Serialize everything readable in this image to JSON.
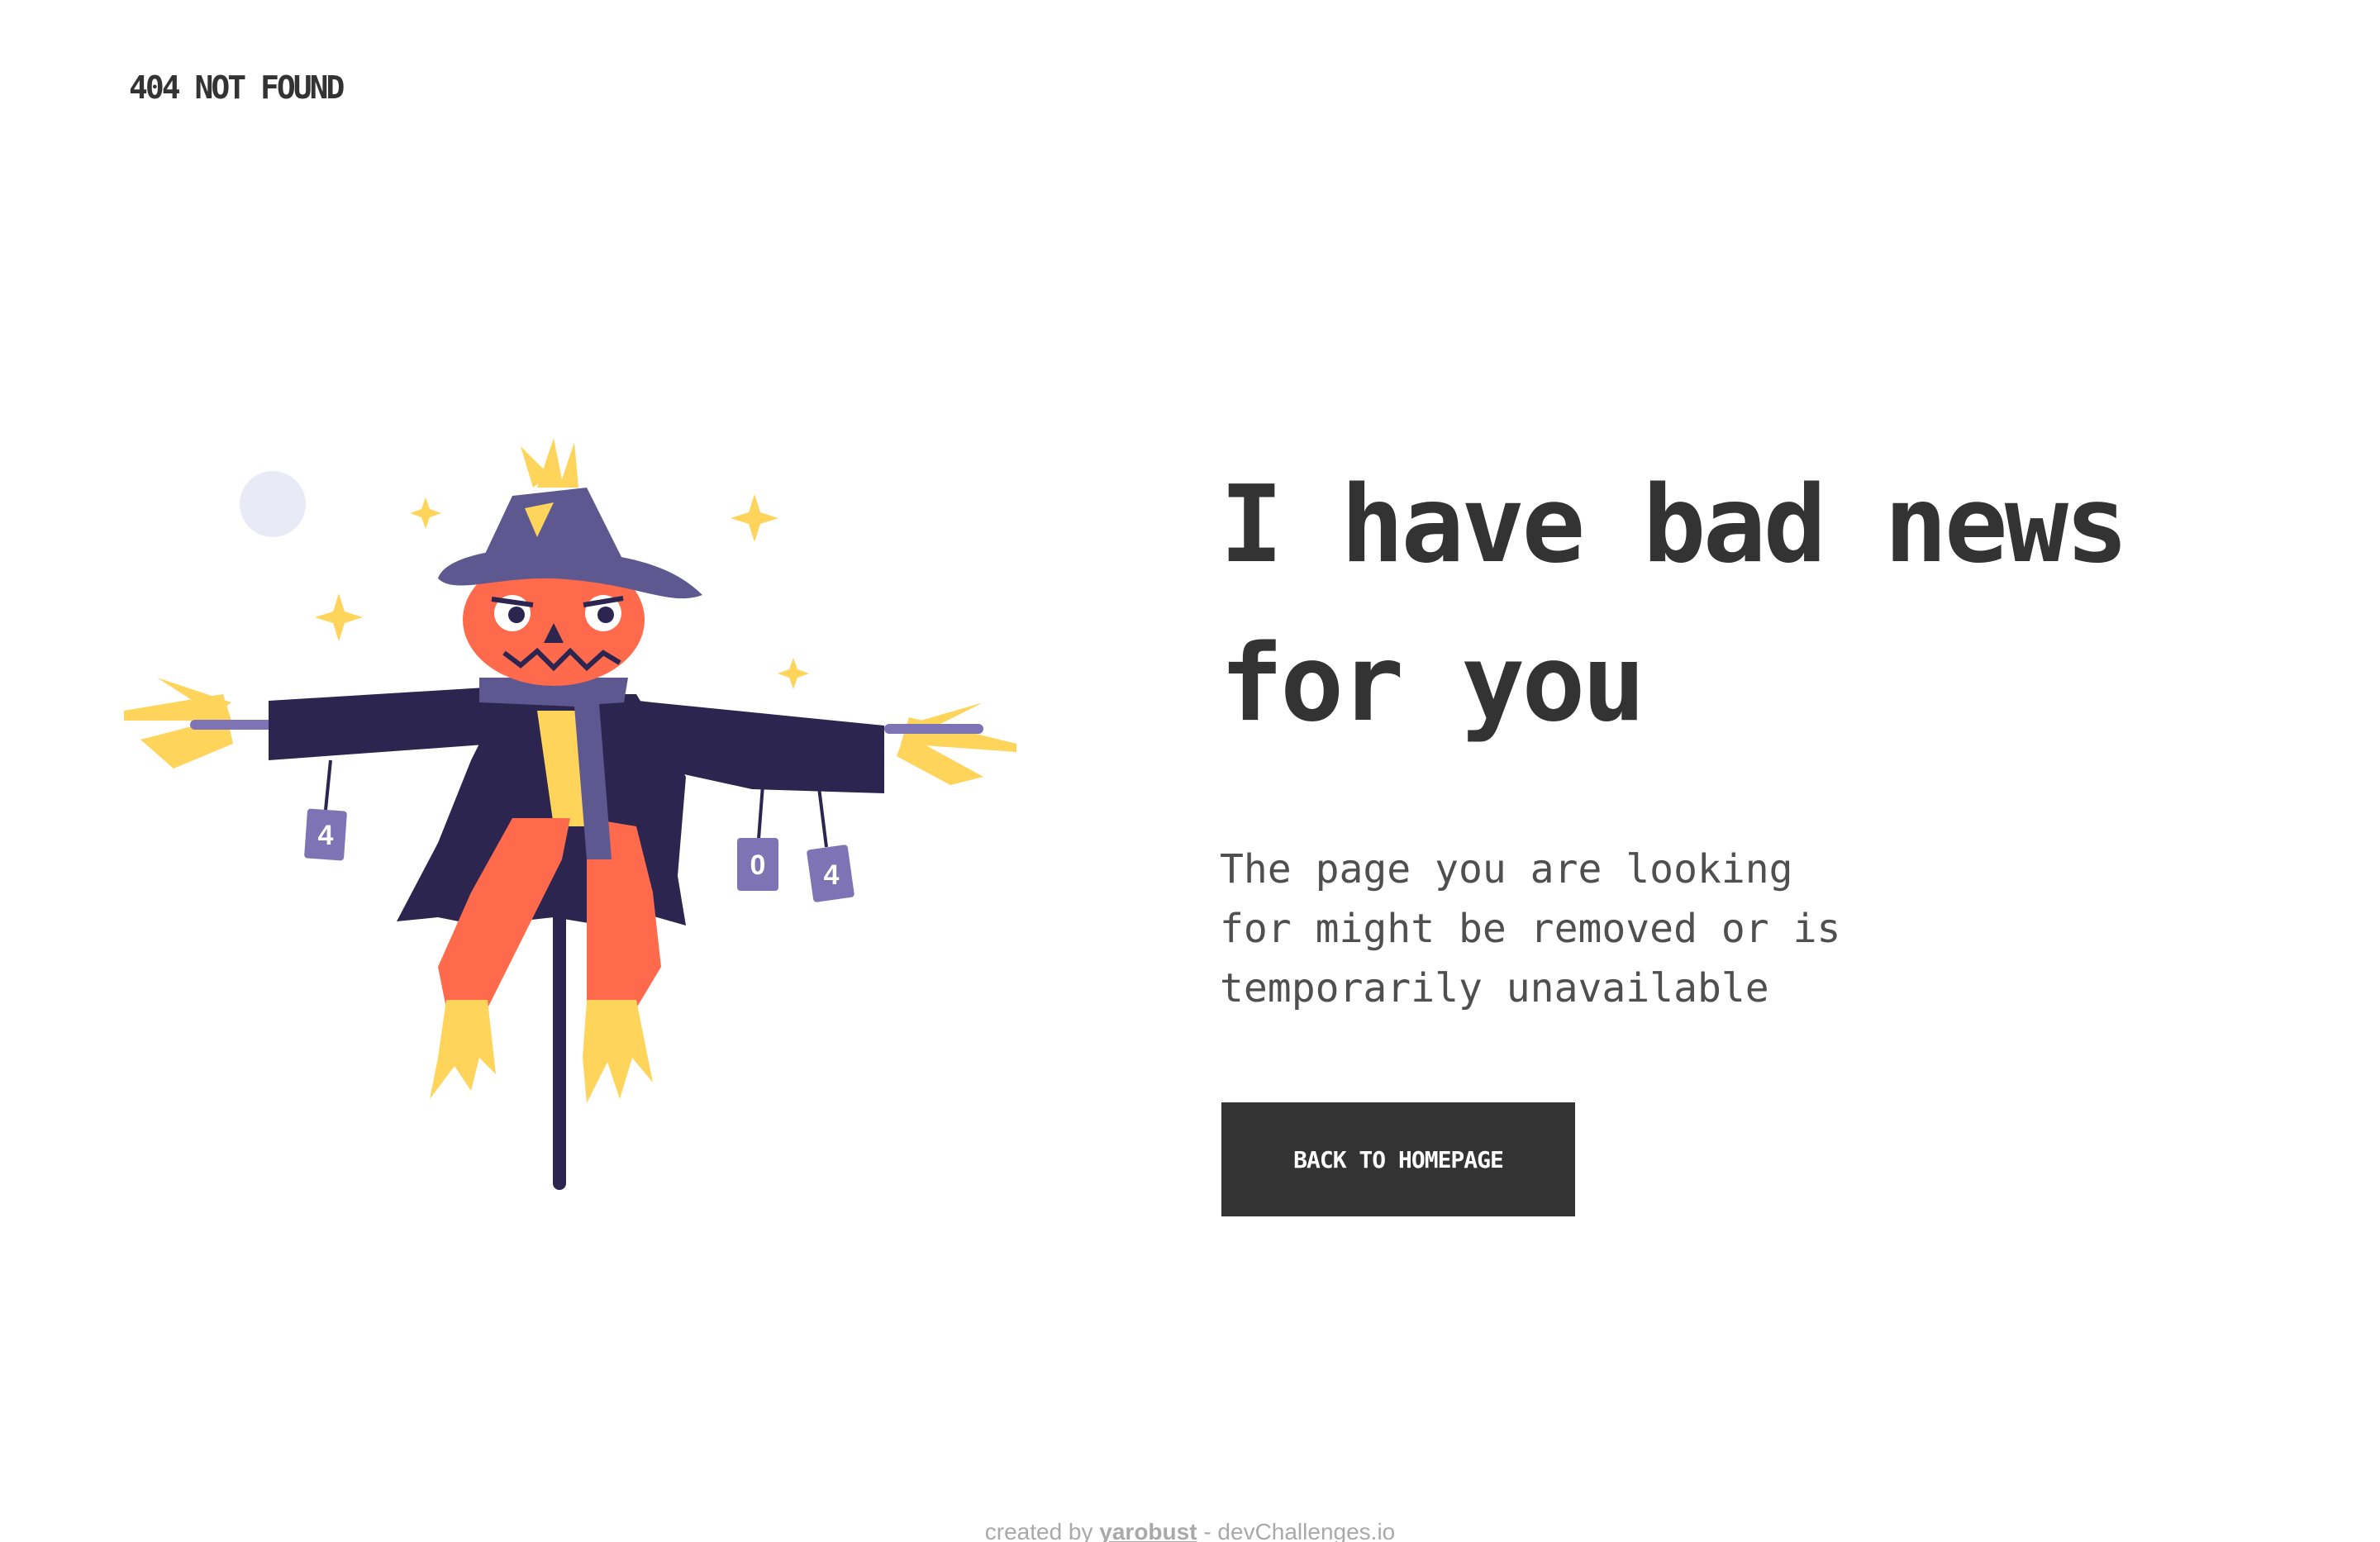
{
  "header": {
    "brand": "404 NOT FOUND"
  },
  "main": {
    "headline_line1": "I have bad news",
    "headline_line2": "for you",
    "message_line1": "The page you are looking",
    "message_line2": "for might be removed or is",
    "message_line3": "temporarily unavailable",
    "button_label": "BACK TO HOMEPAGE"
  },
  "illustration": {
    "can_labels": [
      "4",
      "0",
      "4"
    ]
  },
  "footer": {
    "prefix": "created by",
    "author": "yarobust",
    "separator": "-",
    "site": "devChallenges.io"
  },
  "colors": {
    "text": "#333333",
    "button_bg": "#333333",
    "button_text": "#ffffff",
    "hat": "#5e5890",
    "coat": "#2b2550",
    "pumpkin": "#ff6a4d",
    "straw": "#ffd45a",
    "moon": "#e8eaf6"
  }
}
